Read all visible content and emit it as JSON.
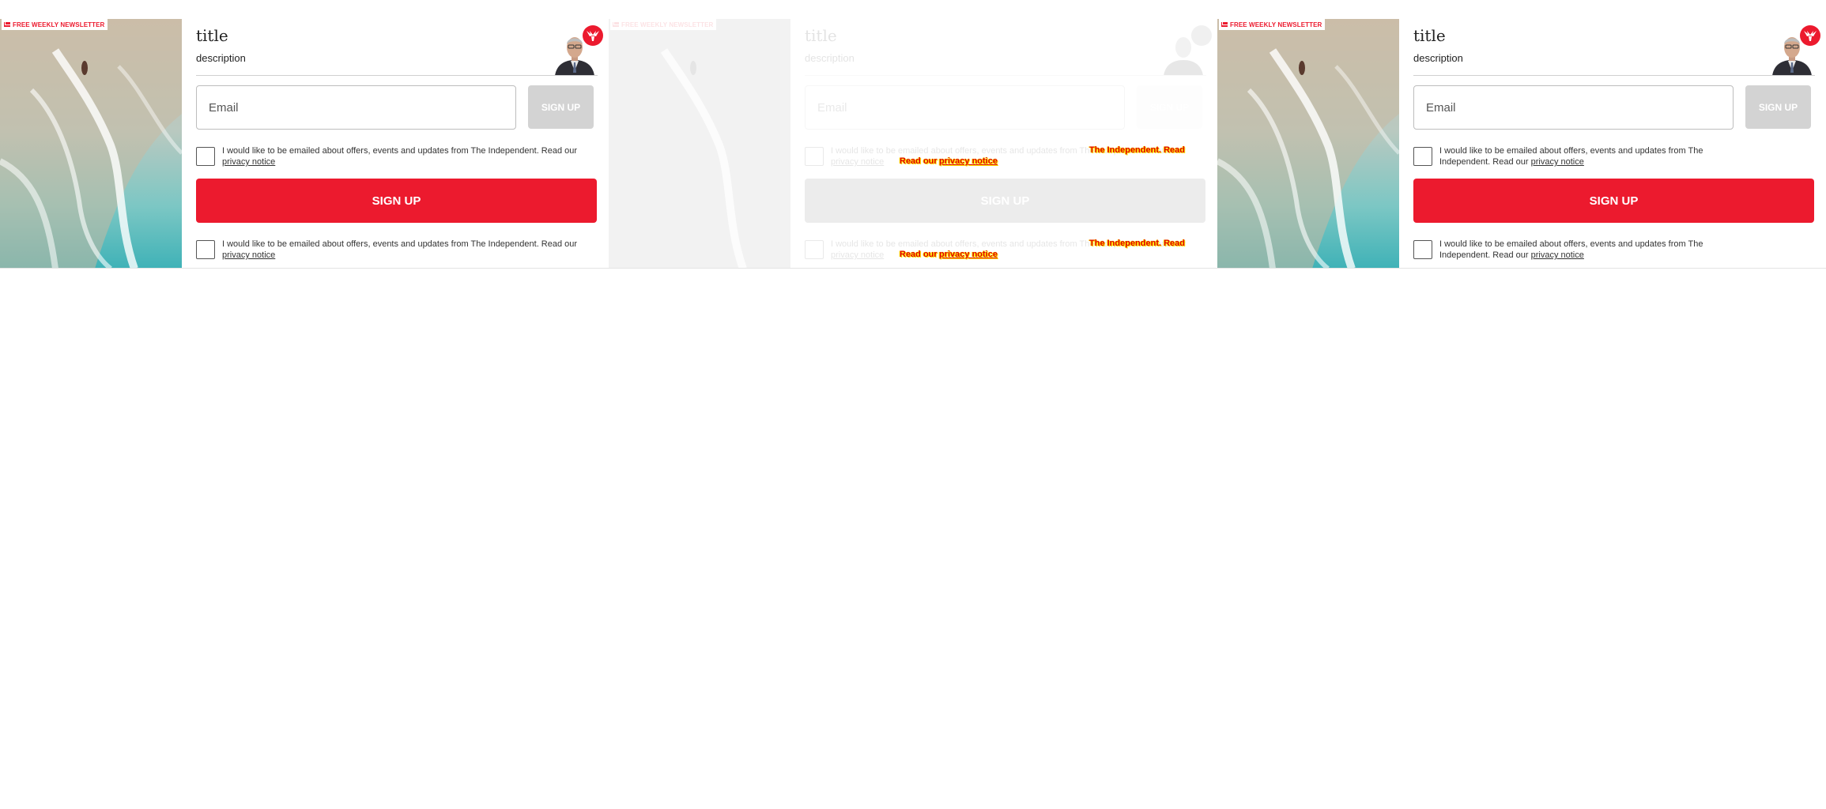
{
  "badge": "FREE WEEKLY NEWSLETTER",
  "title": "title",
  "description": "description",
  "email_placeholder": "Email",
  "small_button": "SIGN UP",
  "big_button": "SIGN UP",
  "consent_text": "I would like to be emailed about offers, events and updates from The Independent. Read our",
  "consent_link": "privacy notice",
  "highlight": {
    "line1": "The Independent. Read",
    "line2_a": "Read our",
    "line2_link": "privacy notice"
  },
  "colors": {
    "brand_red": "#ec1a2e",
    "disabled_button": "#d3d3d3",
    "highlight_yellow": "#ffe600"
  },
  "icons": [
    "mail-icon",
    "independent-eagle-logo",
    "author-photo",
    "checkbox"
  ]
}
